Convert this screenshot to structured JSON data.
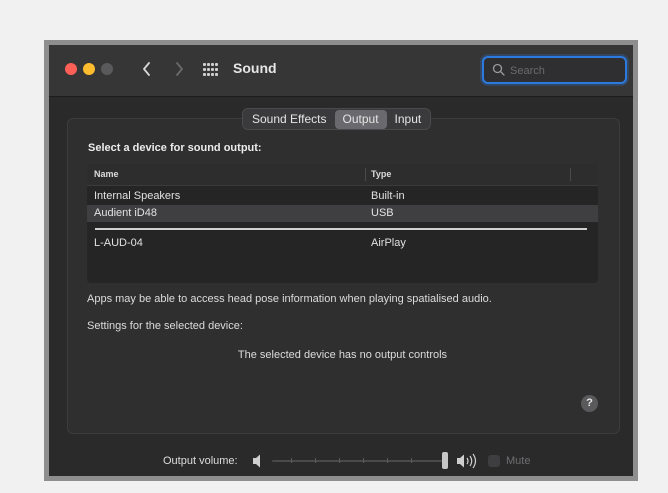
{
  "window": {
    "title": "Sound"
  },
  "search": {
    "placeholder": "Search"
  },
  "tabs": [
    "Sound Effects",
    "Output",
    "Input"
  ],
  "device_heading": "Select a device for sound output:",
  "device_table": {
    "columns": [
      "Name",
      "Type"
    ],
    "rows": [
      {
        "name": "Internal Speakers",
        "type": "Built-in"
      },
      {
        "name": "Audient iD48",
        "type": "USB"
      },
      {
        "name": "L-AUD-04",
        "type": "AirPlay"
      }
    ]
  },
  "info_text": "Apps may be able to access head pose information when playing spatialised audio.",
  "settings_label": "Settings for the selected device:",
  "no_controls_text": "The selected device has no output controls",
  "help": {
    "label": "?"
  },
  "volume": {
    "label": "Output volume:",
    "level": 1.0,
    "mute_label": "Mute",
    "muted": false
  },
  "colors": {
    "accent": "#2c7ae0",
    "close": "#fe5f57",
    "minimize": "#febc2e"
  }
}
